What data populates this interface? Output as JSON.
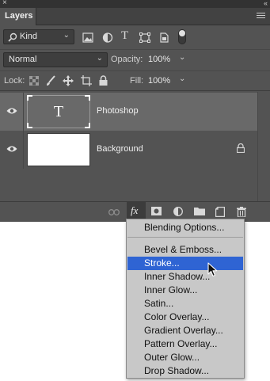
{
  "panel": {
    "tab_label": "Layers",
    "close_glyph": "×",
    "collapse_glyph": "‹‹"
  },
  "filter": {
    "kind_label": "Kind",
    "icons": [
      "pixel-filter-icon",
      "adjustment-filter-icon",
      "type-filter-icon",
      "shape-filter-icon",
      "smart-object-filter-icon",
      "filter-toggle"
    ],
    "type_glyph": "T"
  },
  "blend": {
    "mode": "Normal",
    "opacity_label": "Opacity:",
    "opacity_value": "100%"
  },
  "lock": {
    "label": "Lock:",
    "fill_label": "Fill:",
    "fill_value": "100%"
  },
  "layers": [
    {
      "name": "Photoshop",
      "thumb_glyph": "T",
      "selected": true,
      "visible": true,
      "locked": false
    },
    {
      "name": "Background",
      "selected": false,
      "visible": true,
      "locked": true
    }
  ],
  "bottom_bar": {
    "fx_label": "fx",
    "icons": [
      "link-layers-icon",
      "fx-button",
      "add-mask-icon",
      "adjustment-layer-icon",
      "new-group-icon",
      "new-layer-icon",
      "trash-icon"
    ]
  },
  "fx_menu": {
    "items": [
      "Blending Options...",
      "Bevel & Emboss...",
      "Stroke...",
      "Inner Shadow...",
      "Inner Glow...",
      "Satin...",
      "Color Overlay...",
      "Gradient Overlay...",
      "Pattern Overlay...",
      "Outer Glow...",
      "Drop Shadow..."
    ],
    "highlighted": "Stroke..."
  },
  "colors": {
    "panel_bg": "#535353",
    "selected_row": "#696969",
    "menu_bg": "#c8c8c8",
    "menu_highlight": "#2f64d3"
  }
}
